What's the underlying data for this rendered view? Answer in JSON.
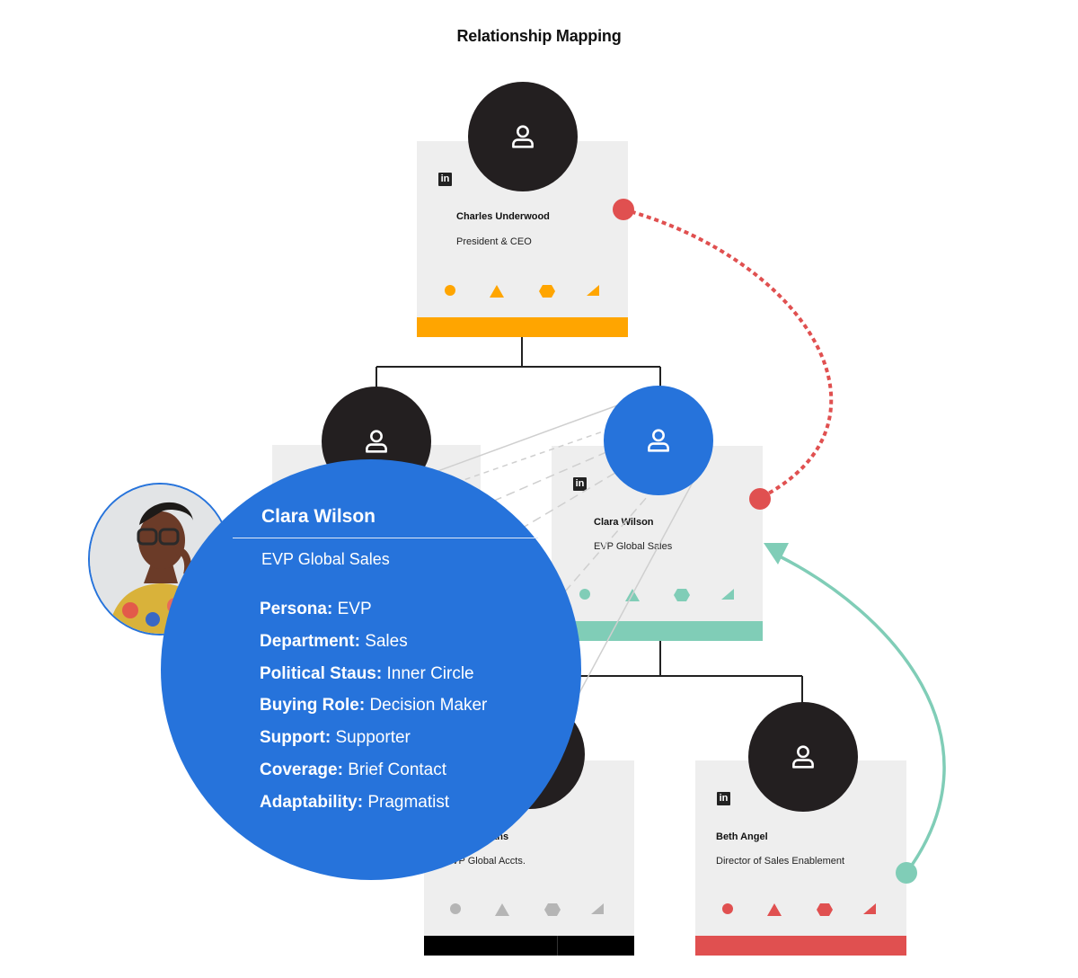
{
  "title": "Relationship Mapping",
  "colors": {
    "orange": "#ffa500",
    "teal": "#80cdb7",
    "red": "#e05050",
    "black": "#000000",
    "blue": "#2673db",
    "dark_avatar": "#231f20",
    "card_bg": "#eeeeee",
    "gray_shape": "#b5b5b5"
  },
  "nodes": [
    {
      "id": "charles",
      "name": "Charles Underwood",
      "role": "President & CEO",
      "linkedin": "in",
      "accent": "orange",
      "avatar": "person-icon"
    },
    {
      "id": "hidden-left",
      "name": "",
      "role": "",
      "linkedin": "in",
      "accent": "black",
      "avatar": "person-icon"
    },
    {
      "id": "clara",
      "name": "Clara Wilson",
      "role": "EVP Global Sales",
      "linkedin": "in",
      "accent": "teal",
      "avatar": "person-icon",
      "selected": true
    },
    {
      "id": "evans",
      "name": "...ans",
      "role": "...VP Global Accts.",
      "linkedin": "in",
      "accent": "black",
      "avatar": "person-icon"
    },
    {
      "id": "beth",
      "name": "Beth Angel",
      "role": "Director of Sales Enablement",
      "linkedin": "in",
      "accent": "red",
      "avatar": "person-icon"
    }
  ],
  "shape_icons": [
    "circle-icon",
    "triangle-icon",
    "hexagon-icon",
    "wedge-icon"
  ],
  "relationships": [
    {
      "from": "charles",
      "to": "clara",
      "style": "dotted",
      "color": "red"
    },
    {
      "from": "beth",
      "to": "clara",
      "style": "solid-arrow",
      "color": "teal"
    }
  ],
  "detail": {
    "name": "Clara Wilson",
    "role": "EVP Global Sales",
    "facts": [
      {
        "label": "Persona:",
        "value": "EVP"
      },
      {
        "label": "Department:",
        "value": "Sales"
      },
      {
        "label": "Political Staus:",
        "value": "Inner Circle"
      },
      {
        "label": "Buying Role:",
        "value": "Decision Maker"
      },
      {
        "label": "Support:",
        "value": "Supporter"
      },
      {
        "label": "Coverage:",
        "value": "Brief Contact"
      },
      {
        "label": "Adaptability:",
        "value": "Pragmatist"
      }
    ]
  }
}
